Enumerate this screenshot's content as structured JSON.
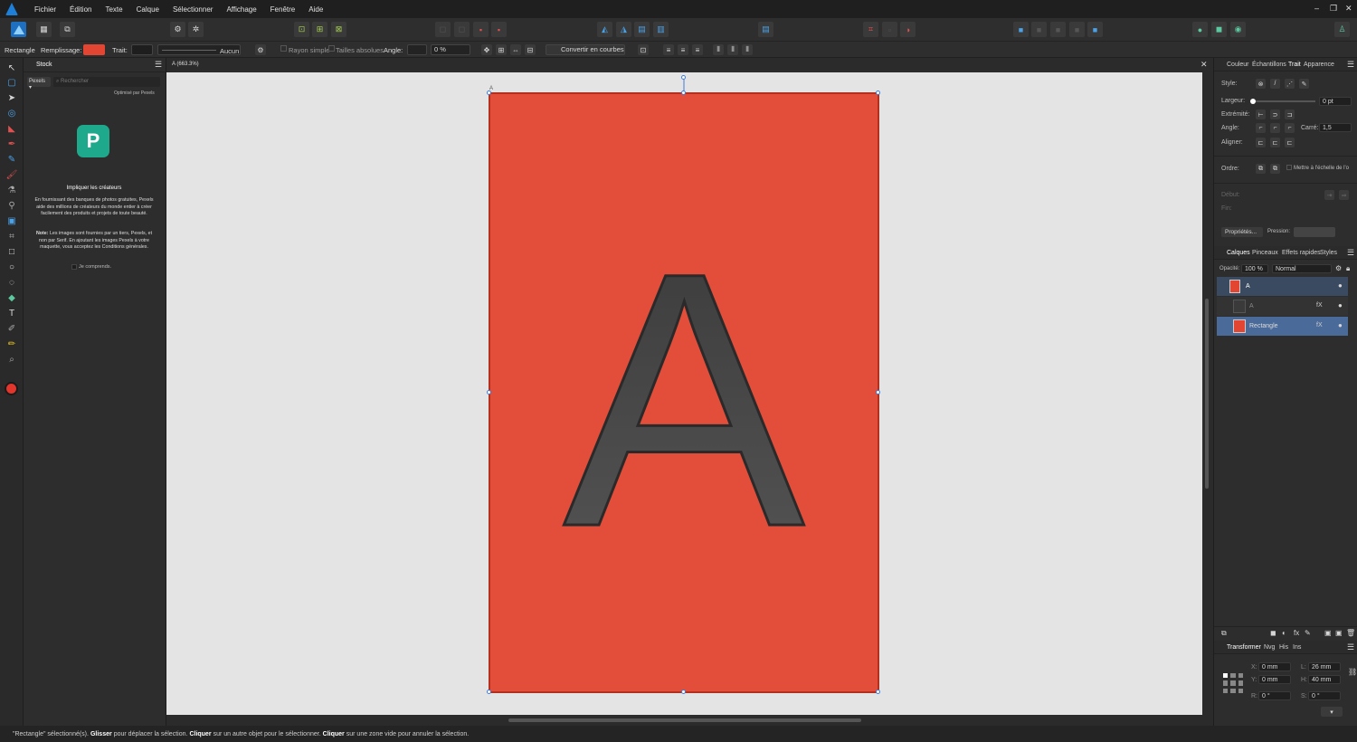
{
  "menu": [
    "Fichier",
    "Édition",
    "Texte",
    "Calque",
    "Sélectionner",
    "Affichage",
    "Fenêtre",
    "Aide"
  ],
  "window_controls": [
    "–",
    "❐",
    "✕"
  ],
  "context": {
    "tool_name": "Rectangle",
    "fill_label": "Remplissage:",
    "fill_color": "#e24632",
    "stroke_label": "Trait:",
    "stroke_none": "Aucun",
    "single_radius": "Rayon simple",
    "absolute_sizes": "Tailles absolues",
    "angle_label": "Angle:",
    "angle_value": "0 %",
    "convert_curves": "Convertir en courbes"
  },
  "stock": {
    "tab": "Stock",
    "source": "Pexels",
    "search_placeholder": "Rechercher",
    "powered": "Optimisé par Pexels",
    "headline": "Impliquer les créateurs",
    "body": "En fournissant des banques de photos gratuites, Pexels aide des millions de créateurs du monde entier à créer facilement des produits et projets de toute beauté.",
    "note_bold": "Note:",
    "note": "Les images sont fournies par un tiers, Pexels, et non par Serif. En ajoutant les images Pexels à votre maquette, vous acceptez les Conditions générales.",
    "agree": "Je comprends."
  },
  "document": {
    "title": "A (663.3%)",
    "letter": "A",
    "rect_color": "#e24e39"
  },
  "stroke_panel": {
    "tabs": [
      "Couleur",
      "Échantillons",
      "Trait",
      "Apparence"
    ],
    "style_label": "Style:",
    "width_label": "Largeur:",
    "width_value": "0 pt",
    "cap_label": "Extrémité:",
    "join_label": "Angle:",
    "miter_label": "Carré:",
    "miter_value": "1,5",
    "align_label": "Aligner:",
    "order_label": "Ordre:",
    "scale_label": "Mettre à l'échelle de l'o",
    "start_label": "Début:",
    "end_label": "Fin:",
    "props_btn": "Propriétés...",
    "pressure_label": "Pression:"
  },
  "layers_panel": {
    "tabs": [
      "Calques",
      "Pinceaux",
      "Effets rapides",
      "Styles"
    ],
    "opacity_label": "Opacité:",
    "opacity_value": "100 %",
    "blend": "Normal",
    "layers": [
      {
        "name": "A",
        "fx": ""
      },
      {
        "name": "A",
        "fx": "fX"
      },
      {
        "name": "Rectangle",
        "fx": "fX"
      }
    ]
  },
  "transform_panel": {
    "tabs": [
      "Transformer",
      "Nvg",
      "His",
      "Ins"
    ],
    "x_label": "X:",
    "x": "0 mm",
    "y_label": "Y:",
    "y": "0 mm",
    "w_label": "L:",
    "w": "26 mm",
    "h_label": "H:",
    "h": "40 mm",
    "r_label": "R:",
    "r": "0 °",
    "s_label": "S:",
    "s": "0 °"
  },
  "status": {
    "t1": "\"Rectangle\" sélectionné(s).",
    "b1": "Glisser",
    "t2": "pour déplacer la sélection.",
    "b2": "Cliquer",
    "t3": "sur un autre objet pour le sélectionner.",
    "b3": "Cliquer",
    "t4": "sur une zone vide pour annuler la sélection."
  }
}
